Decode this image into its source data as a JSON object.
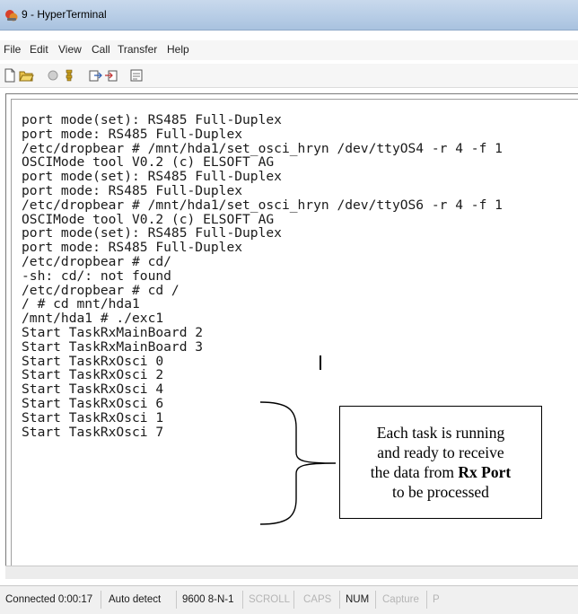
{
  "window": {
    "title": "9 - HyperTerminal"
  },
  "menu": {
    "items": [
      "File",
      "Edit",
      "View",
      "Call",
      "Transfer",
      "Help"
    ]
  },
  "toolbar": {
    "buttons": [
      "new-document-icon",
      "open-folder-icon",
      "connect-phone-icon",
      "disconnect-phone-icon",
      "send-file-icon",
      "receive-file-icon",
      "properties-icon"
    ]
  },
  "terminal": {
    "lines": [
      "port mode(set): RS485 Full-Duplex",
      "port mode: RS485 Full-Duplex",
      "/etc/dropbear # /mnt/hda1/set_osci_hryn /dev/ttyOS4 -r 4 -f 1",
      "OSCIMode tool V0.2 (c) ELSOFT AG",
      "port mode(set): RS485 Full-Duplex",
      "port mode: RS485 Full-Duplex",
      "/etc/dropbear # /mnt/hda1/set_osci_hryn /dev/ttyOS6 -r 4 -f 1",
      "OSCIMode tool V0.2 (c) ELSOFT AG",
      "port mode(set): RS485 Full-Duplex",
      "port mode: RS485 Full-Duplex",
      "/etc/dropbear # cd/",
      "-sh: cd/: not found",
      "/etc/dropbear # cd /",
      "/ # cd mnt/hda1",
      "/mnt/hda1 # ./exc1",
      "Start TaskRxMainBoard 2",
      "Start TaskRxMainBoard 3",
      "Start TaskRxOsci 0",
      "Start TaskRxOsci 2",
      "Start TaskRxOsci 4",
      "Start TaskRxOsci 6",
      "Start TaskRxOsci 1",
      "Start TaskRxOsci 7"
    ]
  },
  "annotation": {
    "line1": "Each task is running",
    "line2": "and ready to receive",
    "line3_prefix": "the data from ",
    "line3_bold": "Rx Port",
    "line4": "to be processed"
  },
  "status": {
    "connected": "Connected 0:00:17",
    "detect": "Auto detect",
    "settings": "9600 8-N-1",
    "scroll": "SCROLL",
    "caps": "CAPS",
    "num": "NUM",
    "capture": "Capture",
    "print": "P"
  },
  "colors": {
    "titlebar": "#b7cde6",
    "terminal_bg": "#ffffff",
    "terminal_text": "#1a1a1a",
    "status_dim": "#b5b5b5"
  }
}
